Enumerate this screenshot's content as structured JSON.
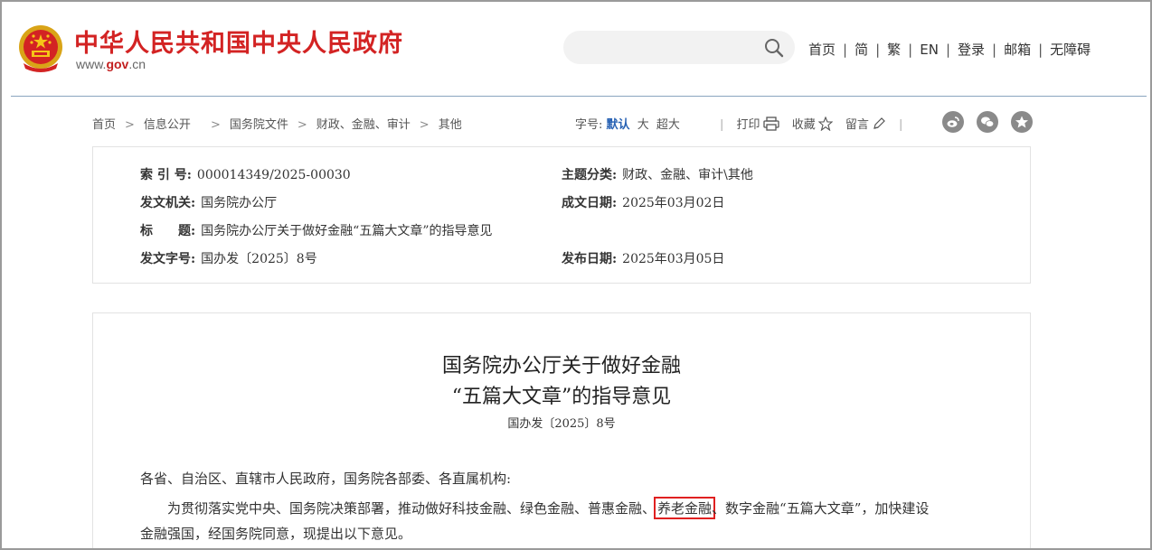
{
  "header": {
    "site_title": "中华人民共和国中央人民政府",
    "site_url_prefix": "www.",
    "site_url_bold": "gov",
    "site_url_suffix": ".cn",
    "search_placeholder": "",
    "nav": [
      "首页",
      "简",
      "繁",
      "EN",
      "登录",
      "邮箱",
      "无障碍"
    ],
    "nav_separator": "|"
  },
  "breadcrumb": {
    "items": [
      "首页",
      "信息公开",
      "国务院文件",
      "财政、金融、审计",
      "其他"
    ],
    "arrow": ">"
  },
  "font_size": {
    "label": "字号:",
    "options": [
      "默认",
      "大",
      "超大"
    ],
    "active": "默认"
  },
  "tools": {
    "print": "打印",
    "favorite": "收藏",
    "comment": "留言",
    "separator": "|"
  },
  "meta": {
    "index_label": "索 引 号:",
    "index_value": "000014349/2025-00030",
    "category_label": "主题分类:",
    "category_value": "财政、金融、审计\\其他",
    "issuer_label": "发文机关:",
    "issuer_value": "国务院办公厅",
    "created_label": "成文日期:",
    "created_value": "2025年03月02日",
    "title_label": "标　　题:",
    "title_value": "国务院办公厅关于做好金融“五篇大文章”的指导意见",
    "docno_label": "发文字号:",
    "docno_value": "国办发〔2025〕8号",
    "published_label": "发布日期:",
    "published_value": "2025年03月05日"
  },
  "article": {
    "title_line1": "国务院办公厅关于做好金融",
    "title_line2": "“五篇大文章”的指导意见",
    "doc_number": "国办发〔2025〕8号",
    "salutation": "各省、自治区、直辖市人民政府，国务院各部委、各直属机构:",
    "para1_before": "为贯彻落实党中央、国务院决策部署，推动做好科技金融、绿色金融、普惠金融、",
    "para1_highlight": "养老金融",
    "para1_after": "、数字金融“五篇大文章”，加快建设",
    "para1_line2": "金融强国，经国务院同意，现提出以下意见。"
  },
  "colors": {
    "brand_red": "#d32323",
    "highlight_border": "#e02020",
    "active_font_size": "#2862b4"
  }
}
